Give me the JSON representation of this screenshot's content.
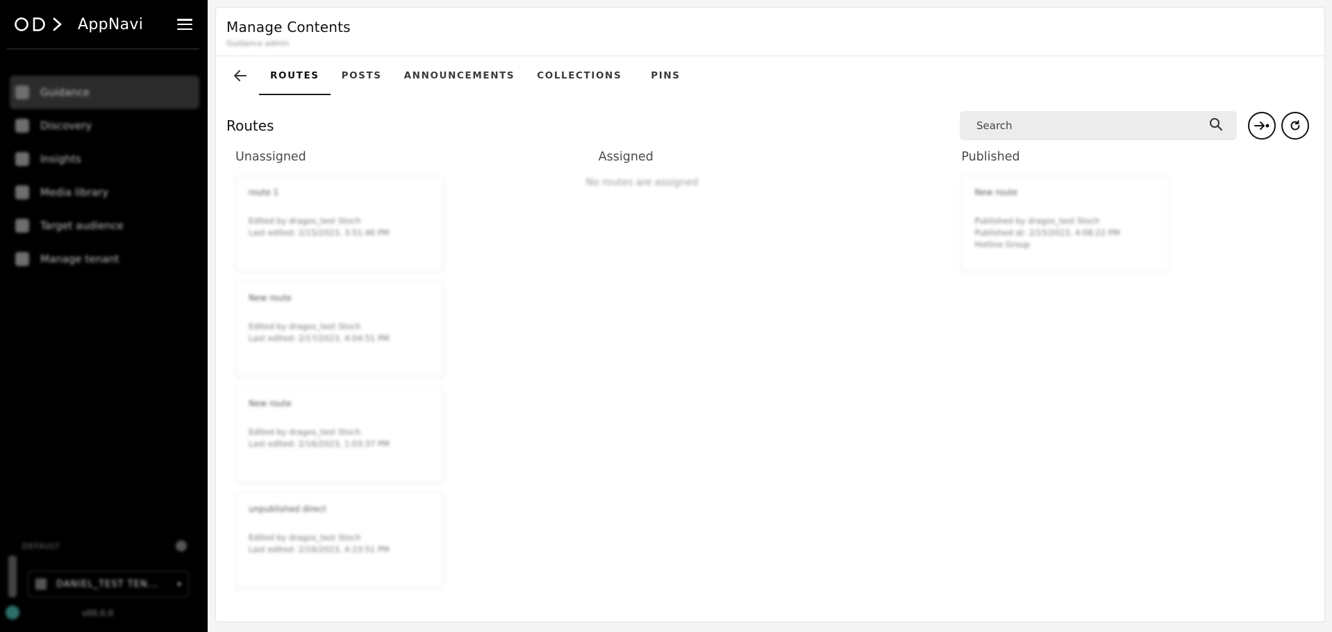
{
  "brand": {
    "name": "AppNavi"
  },
  "sidebar": {
    "items": [
      {
        "label": "Guidance",
        "icon": "guidance-icon",
        "active": true
      },
      {
        "label": "Discovery",
        "icon": "search-icon"
      },
      {
        "label": "Insights",
        "icon": "insights-icon"
      },
      {
        "label": "Media library",
        "icon": "media-icon"
      },
      {
        "label": "Target audience",
        "icon": "target-icon"
      },
      {
        "label": "Manage tenant",
        "icon": "tenant-icon"
      }
    ],
    "footer": {
      "project_label": "DEFAULT",
      "tenant_select": "DANIEL_TEST TEN...",
      "version": "v00.0.0"
    }
  },
  "header": {
    "title": "Manage Contents",
    "subtitle": "Guidance admin"
  },
  "tabs": [
    {
      "label": "ROUTES",
      "active": true
    },
    {
      "label": "POSTS"
    },
    {
      "label": "ANNOUNCEMENTS"
    },
    {
      "label": "COLLECTIONS"
    },
    {
      "label": "PINS"
    }
  ],
  "routes": {
    "title": "Routes",
    "search_placeholder": "Search",
    "columns": {
      "unassigned": {
        "title": "Unassigned",
        "cards": [
          {
            "title": "route 1",
            "line1": "Edited by dragos_test Stoch",
            "line2": "Last edited: 2/15/2023, 3:51:46 PM"
          },
          {
            "title": "New route",
            "line1": "Edited by dragos_test Stoch",
            "line2": "Last edited: 2/17/2023, 4:04:51 PM"
          },
          {
            "title": "New route",
            "line1": "Edited by dragos_test Stoch",
            "line2": "Last edited: 2/16/2023, 1:03:37 PM"
          },
          {
            "title": "unpublished direct",
            "line1": "Edited by dragos_test Stoch",
            "line2": "Last edited: 2/16/2023, 4:23:51 PM"
          }
        ]
      },
      "assigned": {
        "title": "Assigned",
        "empty_text": "No routes are assigned"
      },
      "published": {
        "title": "Published",
        "cards": [
          {
            "title": "New route",
            "line1": "Published by dragos_test Stoch",
            "line2": "Published at: 2/15/2023, 4:08:22 PM",
            "line3": "Hotline Group"
          }
        ]
      }
    }
  },
  "colors": {
    "sidebar_bg": "#000000",
    "accent": "#111111",
    "search_bg": "#ececec"
  }
}
